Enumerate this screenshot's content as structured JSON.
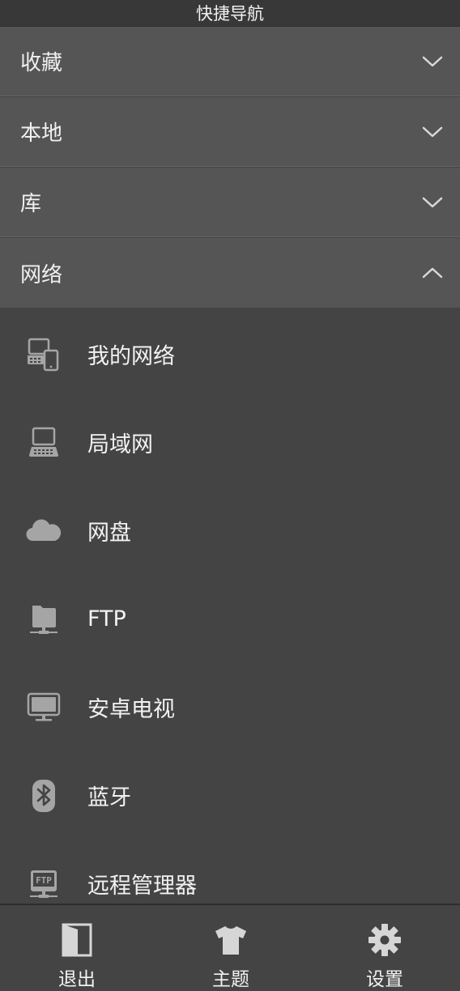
{
  "title": "快捷导航",
  "sections": [
    {
      "label": "收藏",
      "state": "collapsed"
    },
    {
      "label": "本地",
      "state": "collapsed"
    },
    {
      "label": "库",
      "state": "collapsed"
    },
    {
      "label": "网络",
      "state": "expanded"
    }
  ],
  "network_items": [
    {
      "label": "我的网络",
      "icon": "devices-icon"
    },
    {
      "label": "局域网",
      "icon": "computer-icon"
    },
    {
      "label": "网盘",
      "icon": "cloud-icon"
    },
    {
      "label": "FTP",
      "icon": "server-icon"
    },
    {
      "label": "安卓电视",
      "icon": "tv-icon"
    },
    {
      "label": "蓝牙",
      "icon": "bluetooth-icon"
    },
    {
      "label": "远程管理器",
      "icon": "ftp-remote-icon"
    }
  ],
  "bottom_bar": {
    "exit_label": "退出",
    "theme_label": "主题",
    "settings_label": "设置"
  }
}
